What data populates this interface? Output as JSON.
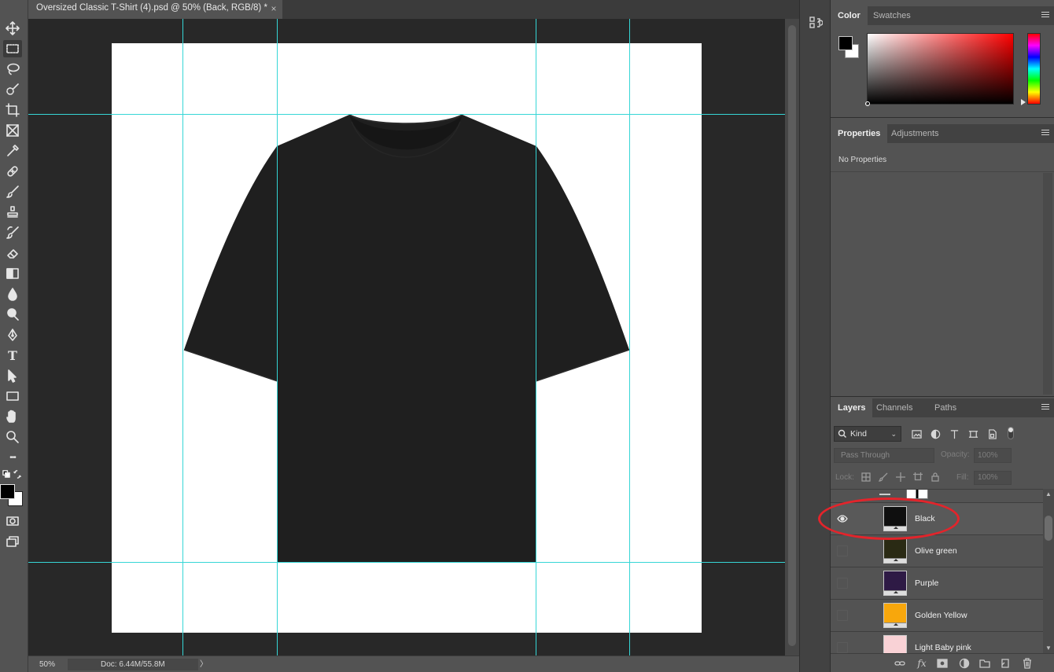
{
  "document": {
    "tab_title": "Oversized Classic T-Shirt (4).psd @ 50% (Back, RGB/8) *",
    "close_glyph": "×"
  },
  "toolbar": {
    "tools": [
      "move-tool",
      "rectangular-marquee-tool",
      "lasso-tool",
      "quick-selection-tool",
      "crop-tool",
      "frame-tool",
      "eyedropper-tool",
      "spot-healing-brush-tool",
      "brush-tool",
      "clone-stamp-tool",
      "history-brush-tool",
      "eraser-tool",
      "gradient-tool",
      "blur-tool",
      "dodge-tool",
      "pen-tool",
      "type-tool",
      "path-selection-tool",
      "rectangle-tool",
      "hand-tool",
      "zoom-tool",
      "edit-toolbar"
    ],
    "active_tool": "rectangular-marquee-tool",
    "type_glyph": "T",
    "more_glyph": "•••",
    "foreground_color": "#000000",
    "background_color": "#ffffff"
  },
  "canvas": {
    "artboard_color": "#ffffff",
    "pasteboard_color": "#282828",
    "guide_color": "#36d6d6",
    "shirt_color": "#1f1f1f"
  },
  "statusbar": {
    "zoom": "50%",
    "doc_info": "Doc: 6.44M/55.8M",
    "arrow": "〉"
  },
  "color_panel": {
    "tabs": [
      "Color",
      "Swatches"
    ],
    "active_tab": "Color",
    "hue": "#ff0000"
  },
  "properties_panel": {
    "tabs": [
      "Properties",
      "Adjustments"
    ],
    "active_tab": "Properties",
    "message": "No Properties"
  },
  "layers_panel": {
    "tabs": [
      "Layers",
      "Channels",
      "Paths"
    ],
    "active_tab": "Layers",
    "filter_kind": "Kind",
    "blend_mode": "Pass Through",
    "opacity_label": "Opacity:",
    "opacity_value": "100%",
    "lock_label": "Lock:",
    "fill_label": "Fill:",
    "fill_value": "100%",
    "layers": [
      {
        "name": "Black",
        "color": "#0f0f0f",
        "visible": true,
        "selected": true
      },
      {
        "name": "Olive green",
        "color": "#2a2a14",
        "visible": false,
        "selected": false
      },
      {
        "name": "Purple",
        "color": "#2e1a45",
        "visible": false,
        "selected": false
      },
      {
        "name": "Golden Yellow",
        "color": "#f8a70c",
        "visible": false,
        "selected": false
      },
      {
        "name": "Light Baby pink",
        "color": "#f9d2d6",
        "visible": false,
        "selected": false
      }
    ]
  },
  "annotation": {
    "color": "#e3242b"
  }
}
